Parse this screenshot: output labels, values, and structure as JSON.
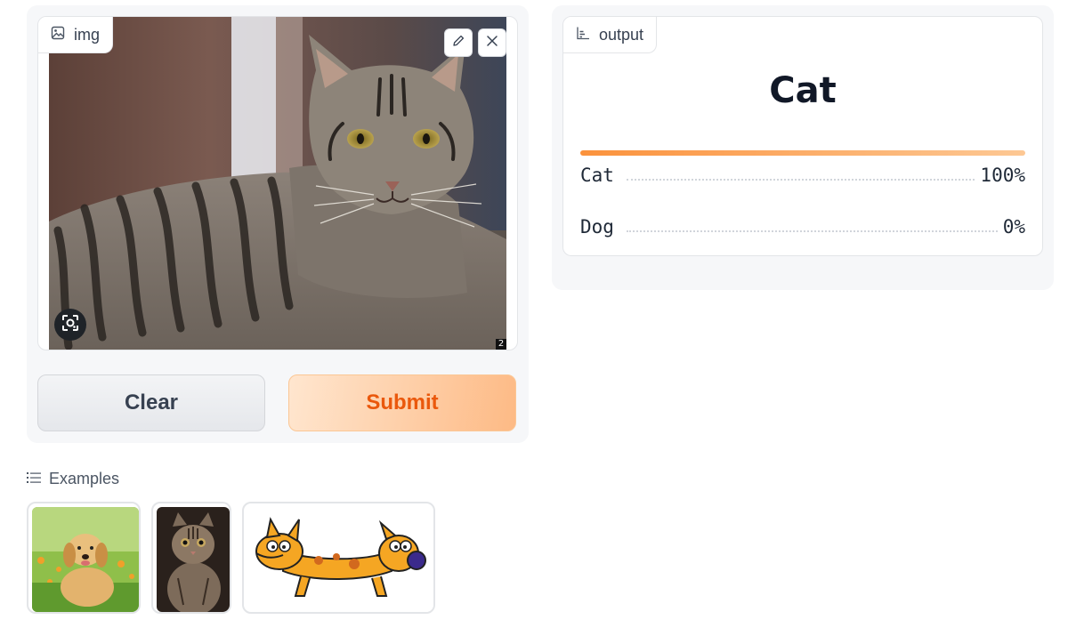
{
  "input": {
    "label": "img"
  },
  "image_overlay": {
    "counter": "2"
  },
  "buttons": {
    "clear": "Clear",
    "submit": "Submit"
  },
  "output": {
    "label": "output",
    "prediction": "Cat",
    "confidences": [
      {
        "label": "Cat",
        "value": "100%"
      },
      {
        "label": "Dog",
        "value": "0%"
      }
    ]
  },
  "examples": {
    "label": "Examples",
    "items": [
      {
        "icon": "puppy-thumbnail"
      },
      {
        "icon": "cat-thumbnail"
      },
      {
        "icon": "catdog-cartoon-thumbnail"
      }
    ]
  },
  "colors": {
    "accent": "#ea580c",
    "bar_start": "#fb923c",
    "bar_end": "#fdc894"
  }
}
